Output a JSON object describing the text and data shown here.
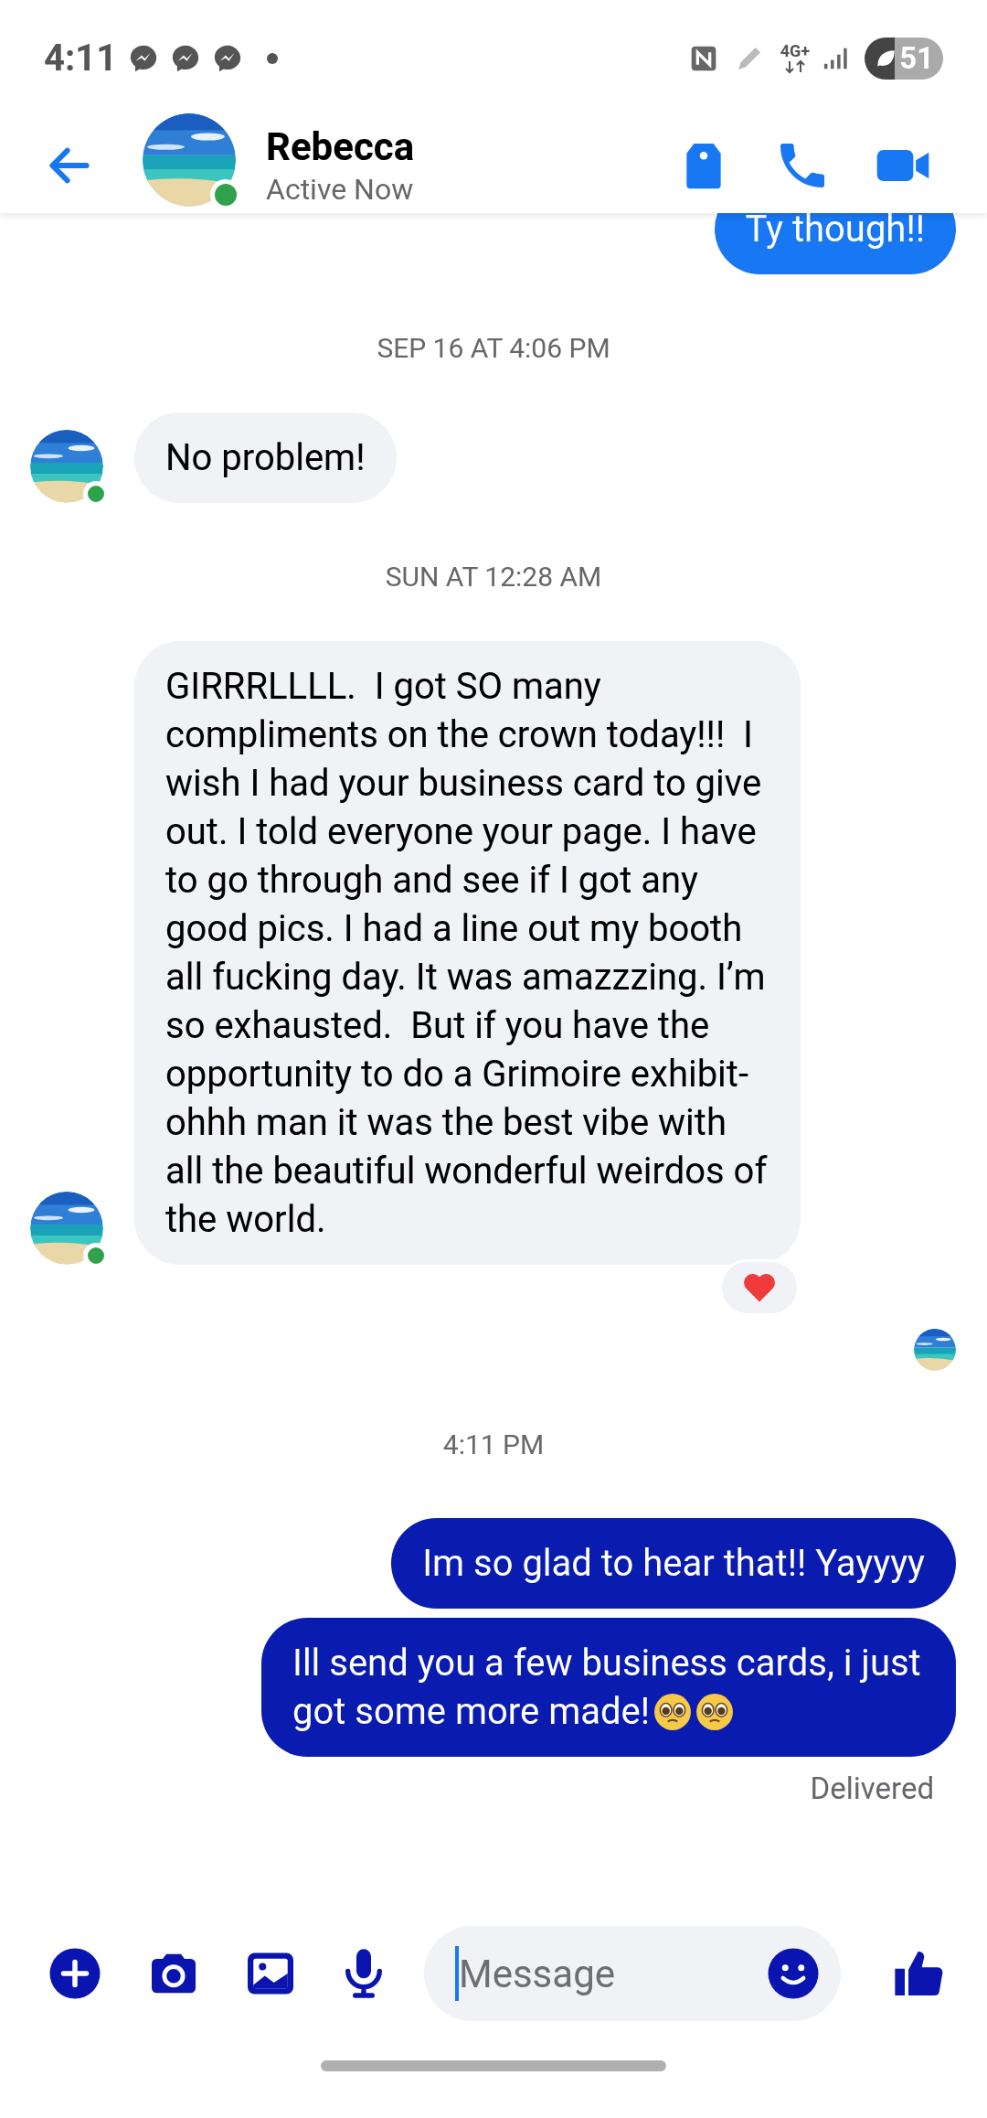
{
  "status_bar": {
    "time": "4:11",
    "network": "4G+",
    "battery": "51"
  },
  "header": {
    "name": "Rebecca",
    "status": "Active Now",
    "online": true
  },
  "messages": [
    {
      "kind": "sent",
      "text": "Ty though!!",
      "color": "#1877f2"
    },
    {
      "kind": "timestamp",
      "text": "SEP 16 AT 4:06 PM"
    },
    {
      "kind": "received",
      "text": "No problem!",
      "avatar": true,
      "online": true
    },
    {
      "kind": "timestamp",
      "text": "SUN AT 12:28 AM"
    },
    {
      "kind": "received",
      "text": "GIRRRLLLL.  I got SO many compliments on the crown today!!!  I wish I had your business card to give out. I told everyone your page. I have to go through and see if I got any good pics. I had a line out my booth all fucking day. It was amazzzing. I’m so exhausted.  But if you have the opportunity to do a Grimoire exhibit- ohhh man it was the best vibe with all the beautiful wonderful weirdos of the world.",
      "avatar": true,
      "online": true,
      "reacted": true
    },
    {
      "kind": "seen"
    },
    {
      "kind": "timestamp",
      "text": "4:11 PM"
    },
    {
      "kind": "sent",
      "text": "Im so glad to hear that!! Yayyyy",
      "color": "#0a1bb0"
    },
    {
      "kind": "sent",
      "text": "Ill send you a few business cards, i just got some more made!",
      "color": "#0a1bb0",
      "emoji": [
        {
          "kind": "pleading"
        },
        {
          "kind": "pleading"
        }
      ]
    },
    {
      "kind": "status",
      "text": "Delivered"
    }
  ],
  "composer": {
    "placeholder": "Message"
  }
}
